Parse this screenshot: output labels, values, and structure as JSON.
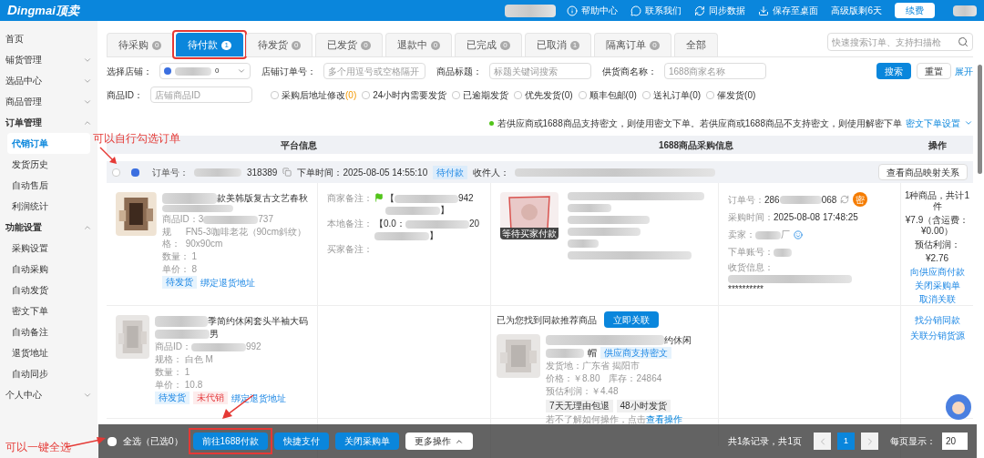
{
  "header": {
    "logo_prefix": "D",
    "logo_rest": "ingmai顶卖",
    "nav": [
      {
        "label": "帮助中心"
      },
      {
        "label": "联系我们"
      },
      {
        "label": "同步数据"
      },
      {
        "label": "保存至桌面"
      }
    ],
    "plan": "高级版剩6天",
    "renew": "续费"
  },
  "sidebar": [
    {
      "label": "首页",
      "expandable": false,
      "expanded": false
    },
    {
      "label": "铺货管理",
      "expandable": true,
      "expanded": false
    },
    {
      "label": "选品中心",
      "expandable": true,
      "expanded": false
    },
    {
      "label": "商品管理",
      "expandable": true,
      "expanded": false
    },
    {
      "label": "订单管理",
      "expandable": true,
      "expanded": true,
      "children": [
        {
          "label": "代销订单",
          "selected": true
        },
        {
          "label": "发货历史",
          "selected": false
        },
        {
          "label": "自动售后",
          "selected": false
        },
        {
          "label": "利润统计",
          "selected": false
        }
      ]
    },
    {
      "label": "功能设置",
      "expandable": true,
      "expanded": true,
      "children": [
        {
          "label": "采购设置",
          "selected": false
        },
        {
          "label": "自动采购",
          "selected": false
        },
        {
          "label": "自动发货",
          "selected": false
        },
        {
          "label": "密文下单",
          "selected": false
        },
        {
          "label": "自动备注",
          "selected": false
        },
        {
          "label": "退货地址",
          "selected": false
        },
        {
          "label": "自动同步",
          "selected": false
        }
      ]
    },
    {
      "label": "个人中心",
      "expandable": true,
      "expanded": false
    }
  ],
  "tabs": [
    {
      "label": "待采购",
      "count": "0",
      "selected": false
    },
    {
      "label": "待付款",
      "count": "1",
      "selected": true
    },
    {
      "label": "待发货",
      "count": "0",
      "selected": false
    },
    {
      "label": "已发货",
      "count": "0",
      "selected": false
    },
    {
      "label": "退款中",
      "count": "0",
      "selected": false
    },
    {
      "label": "已完成",
      "count": "0",
      "selected": false
    },
    {
      "label": "已取消",
      "count": "1",
      "selected": false
    },
    {
      "label": "隔离订单",
      "count": "0",
      "selected": false
    },
    {
      "label": "全部",
      "selected": false
    }
  ],
  "quick_search": {
    "placeholder": "快速搜索订单、支持扫描枪"
  },
  "filters": [
    {
      "kind": "select",
      "label": "选择店铺：",
      "value_tail": "0"
    },
    {
      "kind": "input",
      "label": "店铺订单号：",
      "placeholder": "多个用逗号或空格隔开"
    },
    {
      "kind": "input",
      "label": "商品标题：",
      "placeholder": "标题关键词搜索"
    },
    {
      "kind": "input",
      "label": "供货商名称：",
      "placeholder": "1688商家名称"
    }
  ],
  "filter_buttons": {
    "search": "搜索",
    "reset": "重置",
    "expand": "展开"
  },
  "product_id_filter": {
    "label": "商品ID：",
    "placeholder": "店铺商品ID"
  },
  "checkboxes": [
    {
      "label": "采购后地址修改",
      "count": "(0)",
      "highlight": true,
      "checked": false
    },
    {
      "label": "24小时内需要发货",
      "checked": false
    },
    {
      "label": "已逾期发货",
      "checked": false
    },
    {
      "label": "优先发货(0)",
      "checked": false
    },
    {
      "label": "顺丰包邮(0)",
      "checked": false
    },
    {
      "label": "送礼订单(0)",
      "checked": false
    },
    {
      "label": "催发货(0)",
      "checked": false
    }
  ],
  "notice": {
    "text": "若供应商或1688商品支持密文，则使用密文下单。若供应商或1688商品不支持密文，则使用解密下单",
    "link": "密文下单设置"
  },
  "table": {
    "columns": [
      "平台信息",
      "1688商品采购信息",
      "操作"
    ]
  },
  "order": {
    "checked": false,
    "order_label": "订单号：",
    "order_tail": "318389",
    "time_label": "下单时间：",
    "time": "2025-08-05 14:55:10",
    "status": "待付款",
    "receiver_label": "收件人：",
    "mapping_button": "查看商品映射关系"
  },
  "items": [
    {
      "title_tail": "款美韩版复古文艺春秋",
      "id_label": "商品ID：",
      "id_head": "3",
      "id_tail": "737",
      "spec_label": "规格：",
      "spec": [
        "FN5-3咖啡老花（90cm斜纹）",
        "90x90cm"
      ],
      "qty_label": "数量：",
      "qty": "1",
      "price_label": "单价：",
      "price": "8",
      "tags": [
        {
          "kind": "info",
          "text": "待发货"
        }
      ],
      "link": "绑定退货地址",
      "notes": [
        {
          "label": "商家备注：",
          "flag": true,
          "lines": [
            "【",
            "942",
            "】"
          ]
        },
        {
          "label": "本地备注：",
          "flag": false,
          "lines": [
            "【0.0：",
            "20",
            "】"
          ]
        },
        {
          "label": "买家备注：",
          "flag": false
        }
      ],
      "purchase": {
        "kind": "linked",
        "image_caption": "等待买家付款",
        "order_label": "订单号：",
        "order_head": "286",
        "order_tail": "068",
        "secret_badge": "密",
        "time_label": "采购时间：",
        "time": "2025-08-08 17:48:25",
        "seller_label": "卖家：",
        "seller_tail": "厂",
        "account_label": "下单账号：",
        "address_label": "收货信息：",
        "address_mask": "**********"
      },
      "ops": {
        "summary": "1种商品，共计1件",
        "total": "¥7.9（含运费：¥0.00）",
        "profit_label": "预估利润：",
        "profit": "¥2.76",
        "links": [
          "向供应商付款",
          "关闭采购单",
          "取消关联"
        ]
      }
    },
    {
      "title_tail": "季简约休闲套头半袖大码",
      "title_line2": "男",
      "id_label": "商品ID：",
      "id_tail": "992",
      "spec_label": "规格：",
      "spec": [
        "白色 M"
      ],
      "qty_label": "数量：",
      "qty": "1",
      "price_label": "单价：",
      "price": "10.8",
      "tags": [
        {
          "kind": "info",
          "text": "待发货"
        },
        {
          "kind": "danger",
          "text": "未代销"
        }
      ],
      "link": "绑定退货地址",
      "purchase": {
        "kind": "suggest",
        "found": "已为您找到同款推荐商品",
        "link_button": "立即关联",
        "title_tail": "约休闲",
        "title_line2": "帽",
        "badge": "供应商支持密文",
        "origin": "发货地：广东省 揭阳市",
        "price": "价格：￥8.80",
        "stock": "库存：24864",
        "profit": "预估利润：￥4.48",
        "tags": [
          "7天无理由包退",
          "48小时发货"
        ],
        "help": "若不了解如何操作，点击",
        "help_link": "查看操作"
      },
      "ops": {
        "links": [
          "找分销同款",
          "关联分销货源"
        ]
      }
    }
  ],
  "bottom_bar": {
    "select_all": "全选（已选0）",
    "checked": false,
    "buttons": [
      {
        "kind": "primary",
        "label": "前往1688付款"
      },
      {
        "kind": "primary",
        "label": "快捷支付"
      },
      {
        "kind": "primary",
        "label": "关闭采购单"
      },
      {
        "kind": "plain",
        "label": "更多操作"
      }
    ],
    "summary": "共1条记录，共1页",
    "pages": [
      {
        "label": "1",
        "selected": true
      }
    ],
    "page_size_label": "每页显示：",
    "page_size": "20"
  },
  "annotations": [
    {
      "text": "可以自行勾选订单"
    },
    {
      "text": "可以一键全选"
    }
  ]
}
